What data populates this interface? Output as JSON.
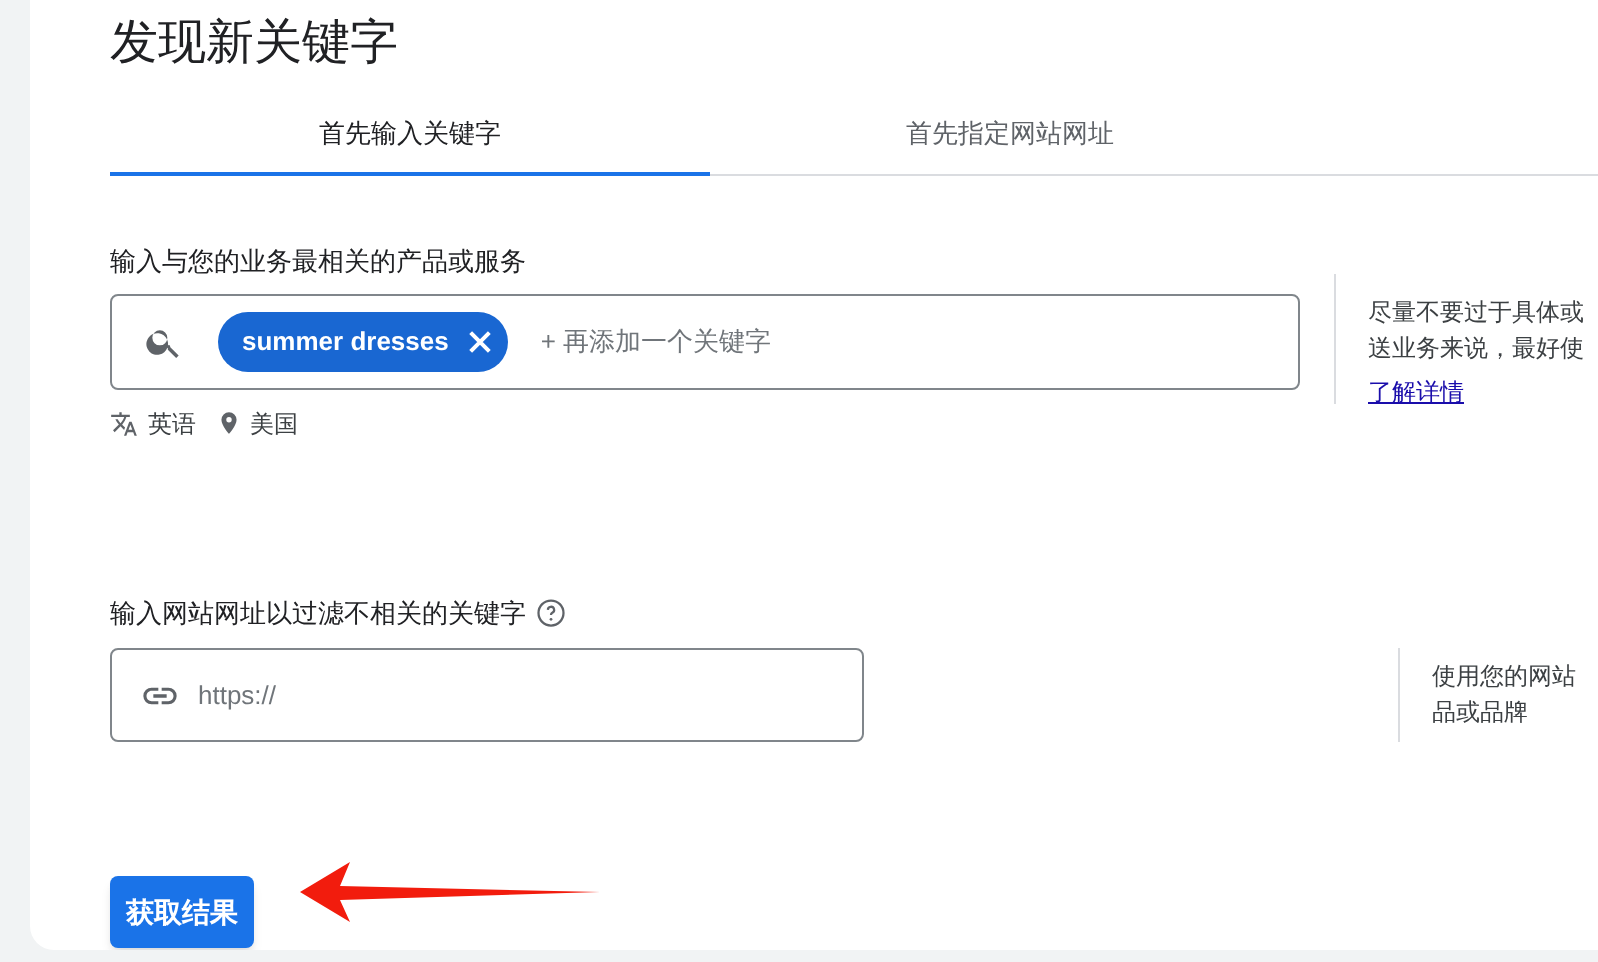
{
  "title": "发现新关键字",
  "tabs": [
    {
      "label": "首先输入关键字",
      "selected": true
    },
    {
      "label": "首先指定网站网址",
      "selected": false
    }
  ],
  "keyword_section": {
    "label": "输入与您的业务最相关的产品或服务",
    "chips": [
      "summer dresses"
    ],
    "placeholder": "+ 再添加一个关键字",
    "language": "英语",
    "location": "美国",
    "help_lines": [
      "尽量不要过于具体或",
      "送业务来说，最好使"
    ],
    "help_link": "了解详情"
  },
  "website_section": {
    "label": "输入网站网址以过滤不相关的关键字",
    "placeholder": "https://",
    "help_lines": [
      "使用您的网站",
      "品或品牌"
    ]
  },
  "submit_button": "获取结果"
}
